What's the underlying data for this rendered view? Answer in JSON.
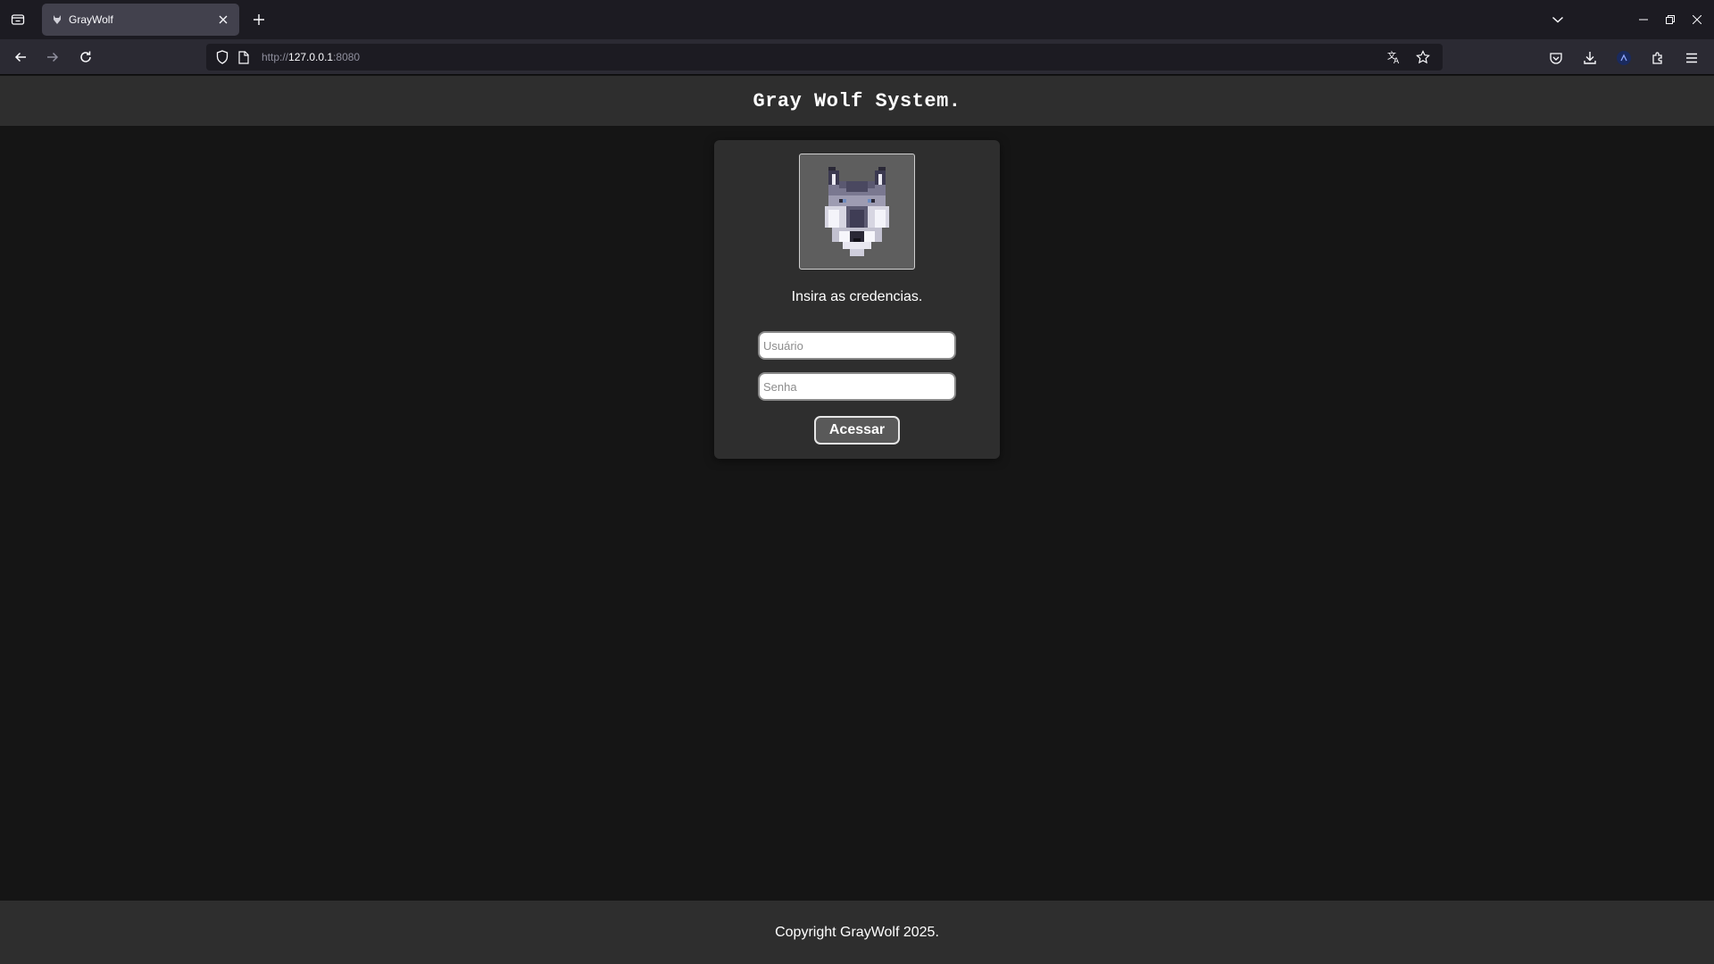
{
  "browser": {
    "tab": {
      "title": "GrayWolf"
    },
    "url": {
      "scheme": "http://",
      "host": "127.0.0.1",
      "port": ":8080"
    }
  },
  "header": {
    "title": "Gray Wolf System."
  },
  "login": {
    "prompt": "Insira as credencias.",
    "username_placeholder": "Usuário",
    "password_placeholder": "Senha",
    "submit_label": "Acessar"
  },
  "footer": {
    "copyright": "Copyright GrayWolf 2025."
  },
  "colors": {
    "page_background": "#151515",
    "header_background": "#2e2e2e",
    "card_background": "#2e2e2e",
    "button_background": "#595959"
  }
}
